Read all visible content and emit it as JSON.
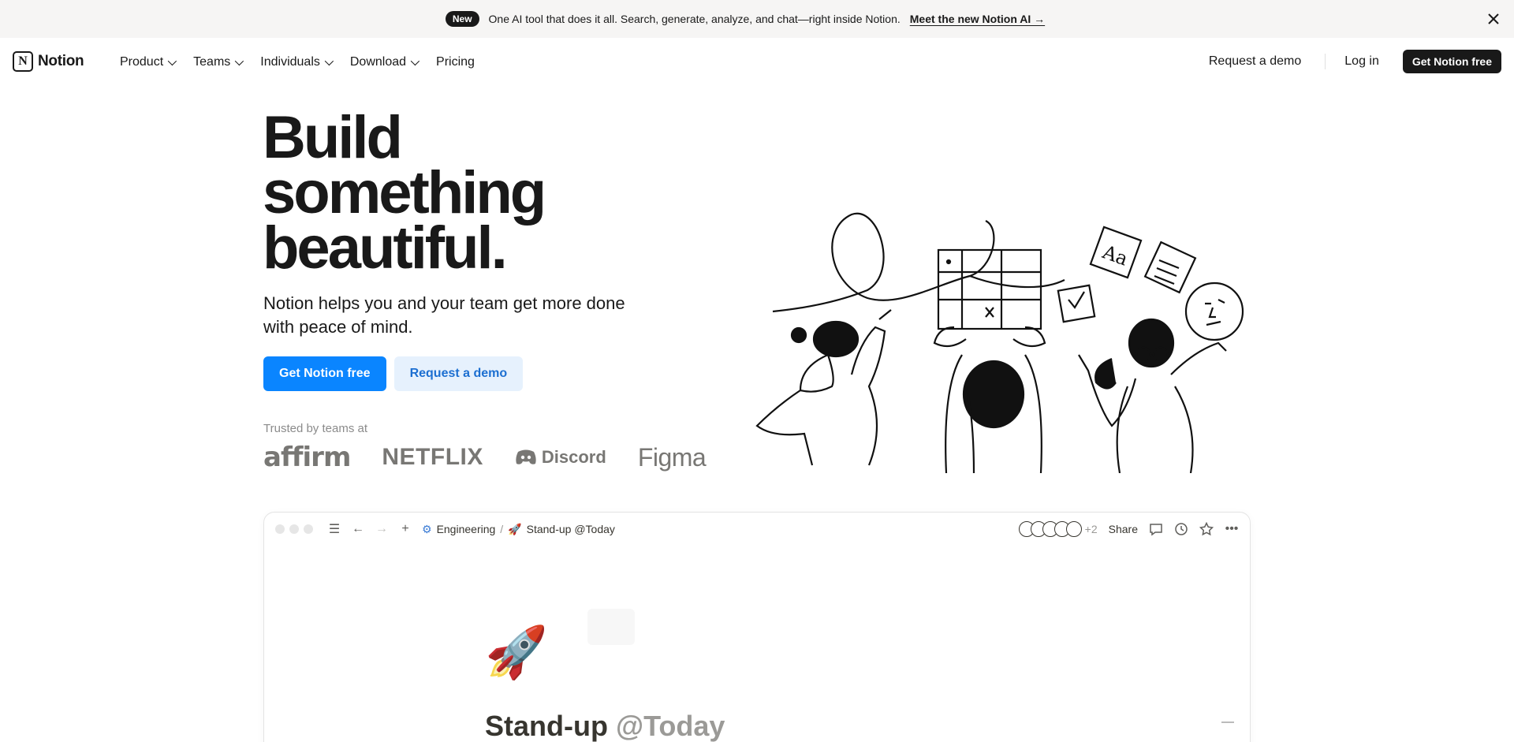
{
  "banner": {
    "badge": "New",
    "text": "One AI tool that does it all. Search, generate, analyze, and chat—right inside Notion.",
    "link": "Meet the new Notion AI →",
    "close_icon": "close-icon"
  },
  "nav": {
    "logo_text": "Notion",
    "logo_mark": "N",
    "items": [
      {
        "label": "Product",
        "has_dropdown": true
      },
      {
        "label": "Teams",
        "has_dropdown": true
      },
      {
        "label": "Individuals",
        "has_dropdown": true
      },
      {
        "label": "Download",
        "has_dropdown": true
      },
      {
        "label": "Pricing",
        "has_dropdown": false
      }
    ],
    "request_demo": "Request a demo",
    "login": "Log in",
    "cta": "Get Notion free"
  },
  "hero": {
    "title_lines": [
      "Build",
      "something",
      "beautiful."
    ],
    "subtitle": "Notion helps you and your team get more done with peace of mind.",
    "primary_cta": "Get Notion free",
    "secondary_cta": "Request a demo",
    "trusted": "Trusted by teams at",
    "logos": [
      "affirm",
      "NETFLIX",
      "Discord",
      "Figma"
    ]
  },
  "window": {
    "breadcrumb": [
      {
        "icon": "⚙",
        "label": "Engineering"
      },
      {
        "icon": "🚀",
        "label": "Stand-up @Today"
      }
    ],
    "crumb_sep": "/",
    "avatar_extra": "+2",
    "share": "Share",
    "page_icon": "🚀",
    "page_title": "Stand-up",
    "page_title_date": "@Today"
  },
  "colors": {
    "primary": "#0a85ff",
    "dark": "#191919",
    "banner_bg": "#f6f5f4",
    "secondary_bg": "#e6f1fd"
  }
}
